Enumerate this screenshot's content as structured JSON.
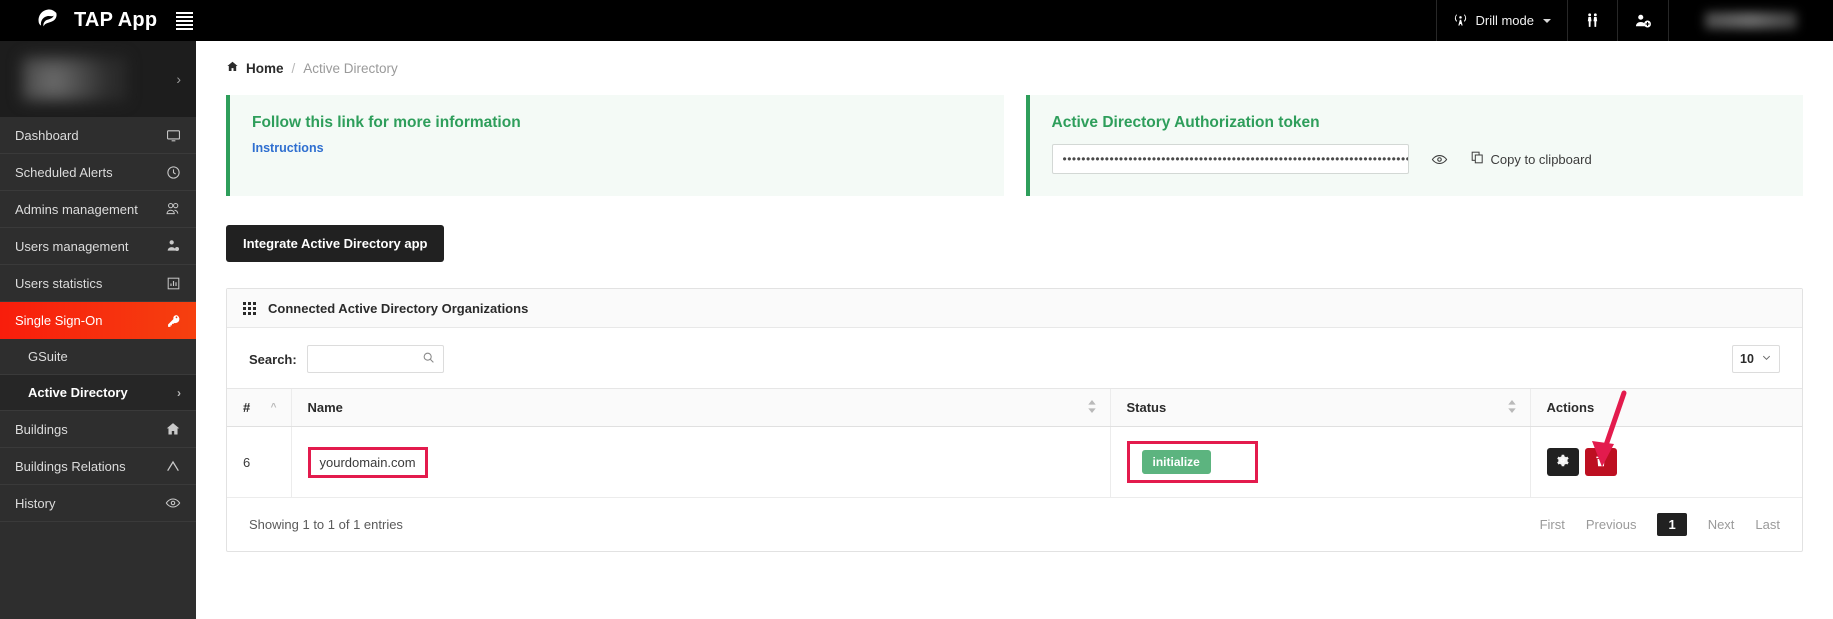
{
  "topbar": {
    "brand": "TAP App",
    "logo_icon": "swirl-logo-icon",
    "menu_icon": "hamburger-menu-icon",
    "drill_mode": "Drill mode",
    "drill_icon": "broadcast-tower-icon",
    "people_icon": "two-people-icon",
    "add_user_icon": "add-user-icon"
  },
  "sidebar": {
    "items": [
      {
        "label": "Dashboard",
        "icon": "monitor-icon"
      },
      {
        "label": "Scheduled Alerts",
        "icon": "clock-icon"
      },
      {
        "label": "Admins management",
        "icon": "admins-icon"
      },
      {
        "label": "Users management",
        "icon": "user-gear-icon"
      },
      {
        "label": "Users statistics",
        "icon": "bar-chart-icon"
      },
      {
        "label": "Single Sign-On",
        "icon": "key-icon"
      }
    ],
    "sub_items": [
      {
        "label": "GSuite"
      },
      {
        "label": "Active Directory",
        "chevron": "›"
      }
    ],
    "items_after": [
      {
        "label": "Buildings",
        "icon": "home-icon"
      },
      {
        "label": "Buildings Relations",
        "icon": "relations-icon"
      },
      {
        "label": "History",
        "icon": "eye-icon"
      }
    ],
    "profile_chevron": "›"
  },
  "breadcrumb": {
    "home": "Home",
    "home_icon": "home-icon",
    "separator": "/",
    "current": "Active Directory"
  },
  "info_panel": {
    "title": "Follow this link for more information",
    "link": "Instructions"
  },
  "token_panel": {
    "title": "Active Directory Authorization token",
    "token_value": "••••••••••••••••••••••••••••••••••••••••••••••••••••••••••••••••••••••••••••••••••",
    "eye_icon": "eye-icon",
    "copy_icon": "copy-icon",
    "copy_label": "Copy to clipboard"
  },
  "integrate_button": "Integrate Active Directory app",
  "card": {
    "title": "Connected Active Directory Organizations",
    "grid_icon": "grid-icon"
  },
  "table": {
    "search_label": "Search:",
    "search_value": "",
    "search_placeholder": "",
    "search_icon": "search-icon",
    "page_length": "10",
    "page_length_icon": "chevron-down-icon",
    "columns": [
      {
        "label": "#",
        "sortable": true,
        "sort_icon": "^"
      },
      {
        "label": "Name",
        "sortable": true,
        "sort_icon": "⌃⌄"
      },
      {
        "label": "Status",
        "sortable": true,
        "sort_icon": "⌃⌄"
      },
      {
        "label": "Actions",
        "sortable": false,
        "sort_icon": ""
      }
    ],
    "rows": [
      {
        "num": "6",
        "name": "yourdomain.com",
        "status": "initialize",
        "gear_icon": "gear-icon",
        "trash_icon": "trash-icon"
      }
    ],
    "info": "Showing 1 to 1 of 1 entries",
    "pagination": {
      "first": "First",
      "previous": "Previous",
      "current": "1",
      "next": "Next",
      "last": "Last"
    }
  },
  "annotations": {
    "arrow_color": "#e31b4d",
    "box_color": "#e31b4d"
  }
}
